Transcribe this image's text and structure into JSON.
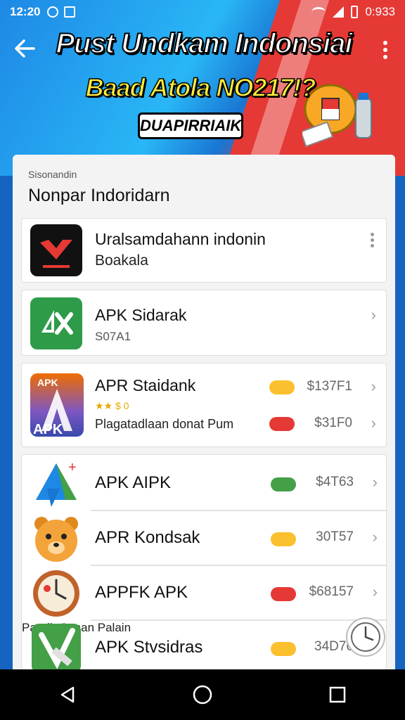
{
  "status_bar": {
    "time": "12:20",
    "battery_text": "0:933"
  },
  "header": {
    "title_line_1": "Pust Undkam Indonsiai",
    "title_line_2": "Baad Atola NO217!?",
    "badge": "DUAPIRRIAIK"
  },
  "card": {
    "subtitle": "Sisonandin",
    "title": "Nonpar Indoridarn"
  },
  "items": [
    {
      "name": "Uralsamdahann indonin",
      "sub": "Boakala"
    },
    {
      "name": "APK Sidarak",
      "sub": "S07A1"
    },
    {
      "name": "APR Staidank",
      "rating": "★★ $ 0",
      "sub": "Plagatadlaan donat Pum",
      "price_1": "$137F1",
      "price_2": "$31F0",
      "pill_1": "",
      "pill_2": ""
    }
  ],
  "list": [
    {
      "name": "APK AIPK",
      "price": "$4T63",
      "pill_color": "green"
    },
    {
      "name": "APR Kondsak",
      "price": "30T57",
      "pill_color": "yellow"
    },
    {
      "name": "APPFK APK",
      "price": "$68157",
      "pill_color": "red"
    },
    {
      "name": "APK Stvsidras",
      "sub": "Pandh Sanan Palain",
      "price": "34D76",
      "pill_color": "yellow"
    }
  ],
  "icon_names": {
    "item_0": "red-chevron-app-icon",
    "item_1": "green-apk-app-icon",
    "item_2": "apk-letter-a-app-icon",
    "list_0": "triangle-play-app-icon",
    "list_1": "bear-face-app-icon",
    "list_2": "clock-face-app-icon",
    "list_3": "green-check-app-icon"
  },
  "colors": {
    "accent_green": "#43a047",
    "accent_yellow": "#fbc02d",
    "accent_red": "#e53935"
  }
}
